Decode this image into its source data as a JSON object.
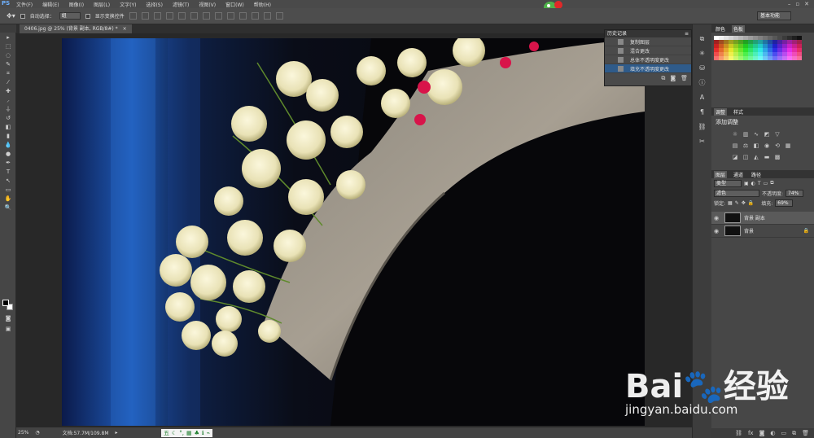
{
  "app": {
    "logo": "PS"
  },
  "menus": [
    "文件(F)",
    "编辑(E)",
    "图像(I)",
    "图层(L)",
    "文字(Y)",
    "选择(S)",
    "滤镜(T)",
    "视图(V)",
    "窗口(W)",
    "帮助(H)"
  ],
  "window_controls": [
    "–",
    "▫",
    "✕"
  ],
  "options": {
    "auto_select_label": "自动选择：",
    "auto_select_value": "组",
    "show_transform_label": "显示变换控件",
    "workspace": "基本功能"
  },
  "document": {
    "tab_title": "0406.jpg @ 25% (背景 副本, RGB/8#) *",
    "close": "×"
  },
  "status": {
    "zoom": "25%",
    "doc_size": "文档:57.7M/109.8M",
    "ime_items": [
      "五",
      "☾",
      "°,",
      "▦",
      "♣",
      "ℹ",
      "⌁"
    ]
  },
  "history": {
    "tabs": [
      "历史记录"
    ],
    "items": [
      {
        "label": "复制图层",
        "active": false
      },
      {
        "label": "混合更改",
        "active": false
      },
      {
        "label": "总体不透明度更改",
        "active": false
      },
      {
        "label": "填充不透明度更改",
        "active": true
      }
    ]
  },
  "color_panel": {
    "tabs": [
      "颜色",
      "色板"
    ]
  },
  "adjust_panel": {
    "tabs": [
      "调整",
      "样式"
    ],
    "title": "添加调整"
  },
  "layers_panel": {
    "tabs": [
      "图层",
      "通道",
      "路径"
    ],
    "filter_label": "类型",
    "blend_mode": "滤色",
    "opacity_label": "不透明度:",
    "opacity_value": "74%",
    "lock_label": "锁定:",
    "fill_label": "填充:",
    "fill_value": "69%",
    "layers": [
      {
        "name": "背景 副本",
        "active": true
      },
      {
        "name": "背景",
        "active": false,
        "locked": true
      }
    ]
  },
  "watermark": {
    "main": "Bai🐾经验",
    "sub": "jingyan.baidu.com"
  },
  "colors": {
    "accent": "#2f5b8a",
    "panel": "#474747",
    "menubar": "#4a4a4a"
  }
}
